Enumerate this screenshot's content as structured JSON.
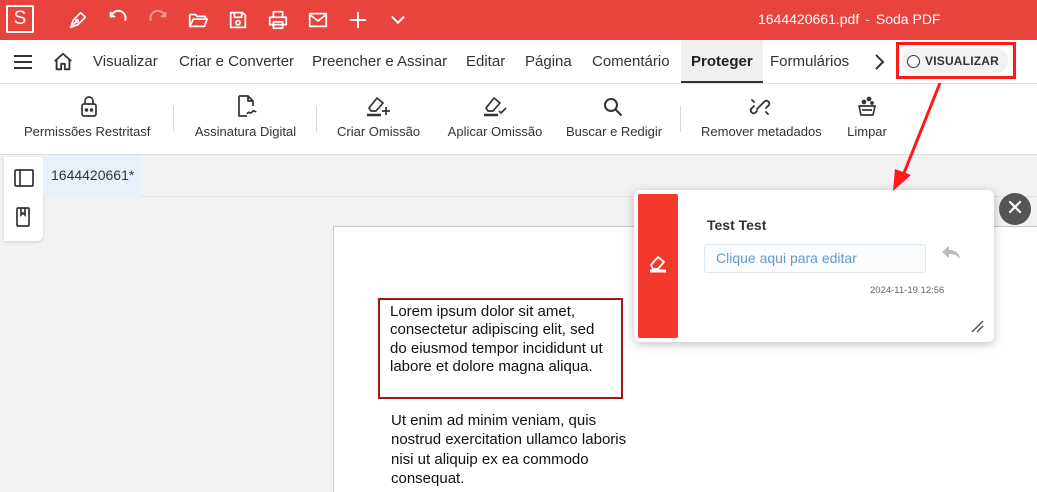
{
  "app": {
    "logo_letter": "S",
    "file_name": "1644420661.pdf",
    "separator": "-",
    "app_name": "Soda PDF",
    "accent_color": "#e8433d"
  },
  "quick_access": [
    "pen-icon",
    "undo-icon",
    "redo-icon",
    "folder-open-icon",
    "save-icon",
    "print-icon",
    "mail-icon",
    "plus-icon",
    "chevron-down-icon"
  ],
  "menu": {
    "items": [
      "Visualizar",
      "Criar e Converter",
      "Preencher e Assinar",
      "Editar",
      "Página",
      "Comentário",
      "Proteger",
      "Formulários"
    ],
    "active": "Proteger",
    "visualizar_button": "VISUALIZAR"
  },
  "ribbon": {
    "items": [
      {
        "label": "Permissões Restritasf",
        "icon": "lock-icon"
      },
      {
        "label": "Assinatura Digital",
        "icon": "signature-icon"
      },
      {
        "label": "Criar Omissão",
        "icon": "eraser-plus-icon"
      },
      {
        "label": "Aplicar Omissão",
        "icon": "eraser-check-icon"
      },
      {
        "label": "Buscar e Redigir",
        "icon": "search-icon"
      },
      {
        "label": "Remover metadados",
        "icon": "unlink-icon"
      },
      {
        "label": "Limpar",
        "icon": "clean-icon"
      }
    ]
  },
  "document": {
    "tab_label": "1644420661*",
    "paragraph1": "Lorem ipsum dolor sit amet, consectetur adipiscing elit, sed do eiusmod tempor incididunt ut labore et dolore magna aliqua.",
    "paragraph2": "Ut enim ad minim veniam, quis nostrud exercitation ullamco laboris nisi ut aliquip ex ea commodo consequat."
  },
  "comment": {
    "author": "Test Test",
    "placeholder": "Clique aqui para editar",
    "date": "2024-11-19 12:56",
    "strip_color": "#f2392b"
  }
}
